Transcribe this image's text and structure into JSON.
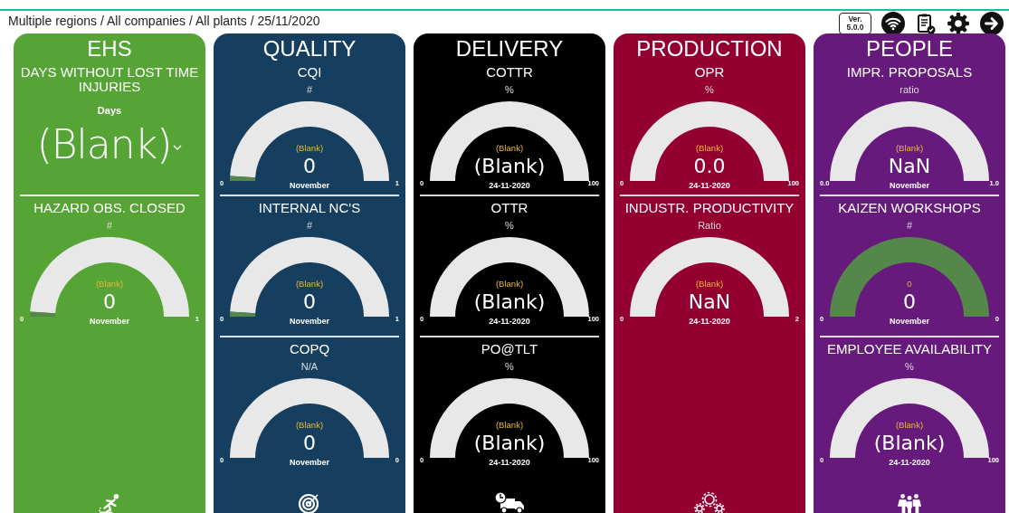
{
  "header": {
    "breadcrumb": "Multiple regions / All companies / All plants / 25/11/2020",
    "version": "Ver. 5.0.0"
  },
  "cards": [
    {
      "title": "EHS",
      "color": "#56a436",
      "sections": [
        {
          "kind": "bigvalue",
          "name": "DAYS WITHOUT LOST TIME INJURIES",
          "unit": "Days",
          "value": "(Blank)"
        },
        {
          "kind": "lowgauge",
          "name": "HAZARD OBS. CLOSED",
          "unit": "#",
          "target": "(Blank)",
          "value": "0",
          "caption": "November",
          "min": "0",
          "max": "1"
        }
      ]
    },
    {
      "title": "QUALITY",
      "color": "#163e5f",
      "sections": [
        {
          "kind": "lowgauge",
          "name": "CQI",
          "unit": "#",
          "target": "(Blank)",
          "value": "0",
          "caption": "November",
          "min": "0",
          "max": "1"
        },
        {
          "kind": "lowgauge",
          "name": "INTERNAL NC'S",
          "unit": "#",
          "target": "(Blank)",
          "value": "0",
          "caption": "November",
          "min": "0",
          "max": "1"
        },
        {
          "kind": "gauge",
          "name": "COPQ",
          "unit": "N/A",
          "target": "(Blank)",
          "value": "0",
          "caption": "November",
          "min": "0",
          "max": "0"
        }
      ]
    },
    {
      "title": "DELIVERY",
      "color": "#000000",
      "sections": [
        {
          "kind": "gauge",
          "name": "COTTR",
          "unit": "%",
          "target": "(Blank)",
          "value": "(Blank)",
          "caption": "24-11-2020",
          "min": "0",
          "max": "100"
        },
        {
          "kind": "gauge",
          "name": "OTTR",
          "unit": "%",
          "target": "(Blank)",
          "value": "(Blank)",
          "caption": "24-11-2020",
          "min": "0",
          "max": "100"
        },
        {
          "kind": "gauge",
          "name": "PO@TLT",
          "unit": "%",
          "target": "(Blank)",
          "value": "(Blank)",
          "caption": "24-11-2020",
          "min": "0",
          "max": "100"
        }
      ]
    },
    {
      "title": "PRODUCTION",
      "color": "#930030",
      "sections": [
        {
          "kind": "gauge",
          "name": "OPR",
          "unit": "%",
          "target": "(Blank)",
          "value": "0.0",
          "caption": "24-11-2020",
          "min": "0",
          "max": "100"
        },
        {
          "kind": "gauge",
          "name": "INDUSTR. PRODUCTIVITY",
          "unit": "Ratio",
          "target": "(Blank)",
          "value": "NaN",
          "caption": "24-11-2020",
          "min": "0",
          "max": "2"
        }
      ]
    },
    {
      "title": "PEOPLE",
      "color": "#661b7c",
      "sections": [
        {
          "kind": "gauge",
          "name": "IMPR. PROPOSALS",
          "unit": "ratio",
          "target": "(Blank)",
          "value": "NaN",
          "caption": "November",
          "min": "0.0",
          "max": "1.0"
        },
        {
          "kind": "fullgauge",
          "name": "KAIZEN WORKSHOPS",
          "unit": "#",
          "target": "0",
          "value": "0",
          "caption": "November",
          "min": "0",
          "max": "0"
        },
        {
          "kind": "gauge",
          "name": "EMPLOYEE AVAILABILITY",
          "unit": "%",
          "target": "(Blank)",
          "value": "(Blank)",
          "caption": "24-11-2020",
          "min": "0",
          "max": "100"
        }
      ]
    }
  ]
}
